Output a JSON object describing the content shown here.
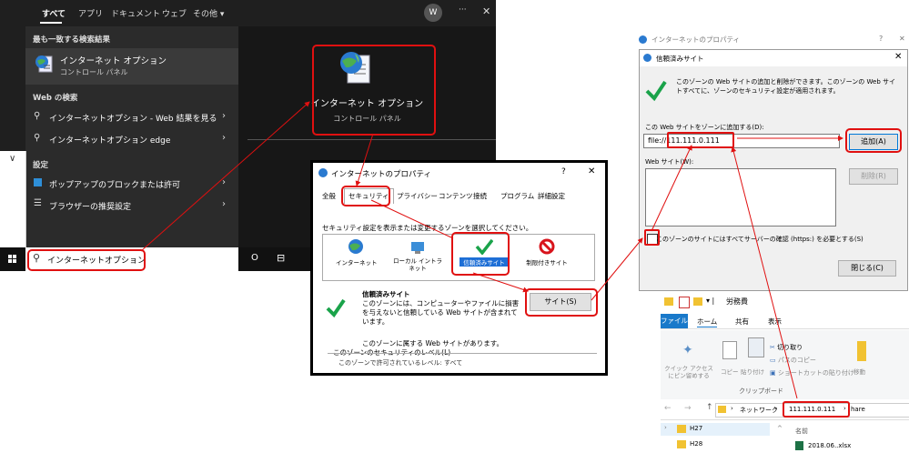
{
  "search": {
    "tabs": [
      "すべて",
      "アプリ",
      "ドキュメント",
      "ウェブ",
      "その他 ▾"
    ],
    "avatar": "W",
    "more": "···",
    "close": "✕",
    "best_match_header": "最も一致する検索結果",
    "best_match_title": "インターネット オプション",
    "best_match_sub": "コントロール パネル",
    "web_header": "Web の検索",
    "web_items": [
      "インターネットオプション - Web 結果を見る",
      "インターネットオプション edge"
    ],
    "settings_header": "設定",
    "settings_items": [
      "ポップアップのブロックまたは許可",
      "ブラウザーの推奨設定"
    ],
    "detail_title": "インターネット オプション",
    "detail_sub": "コントロール パネル",
    "query": "インターネットオプション",
    "chevron": "∨"
  },
  "props1": {
    "title": "インターネットのプロパティ",
    "help": "?",
    "close": "✕",
    "tabs": [
      "全般",
      "セキュリティ",
      "プライバシー",
      "コンテンツ",
      "接続",
      "プログラム",
      "詳細設定"
    ],
    "instruction": "セキュリティ設定を表示または変更するゾーンを選択してください。",
    "zones": [
      "インターネット",
      "ローカル イントラネット",
      "信頼済みサイト",
      "制限付きサイト"
    ],
    "zone_title": "信頼済みサイト",
    "zone_desc": "このゾーンには、コンピューターやファイルに損害を与えないと信頼している Web サイトが含まれています。",
    "sites_button": "サイト(S)",
    "zone_note": "このゾーンに属する Web サイトがあります。",
    "level_label": "このゾーンのセキュリティのレベル(L)",
    "cut_text": "このゾーンで許可されているレベル: すべて"
  },
  "props2": {
    "title": "インターネットのプロパティ",
    "help": "?",
    "close": "✕"
  },
  "trusted": {
    "title": "信頼済みサイト",
    "close": "✕",
    "info": "このゾーンの Web サイトの追加と削除ができます。このゾーンの Web サイトすべてに、ゾーンのセキュリティ設定が適用されます。",
    "add_label": "この Web サイトをゾーンに追加する(D):",
    "url_value": "file://111.111.0.111",
    "add_button": "追加(A)",
    "list_label": "Web サイト(W):",
    "remove_button": "削除(R)",
    "https_label": "このゾーンのサイトにはすべてサーバーの確認 (https:) を必要とする(S)",
    "close_button": "閉じる(C)"
  },
  "explorer": {
    "title": "労務費",
    "ribbon_tabs": [
      "ファイル",
      "ホーム",
      "共有",
      "表示"
    ],
    "pin_label": "クイック アクセス にピン留めする",
    "copy_label": "コピー",
    "paste_label": "貼り付け",
    "cut_label": "切り取り",
    "copy_path_label": "パスのコピー",
    "shortcut_label": "ショートカットの貼り付け",
    "move_label": "移動",
    "clipboard_group": "クリップボード",
    "breadcrumb_network": "ネットワーク",
    "breadcrumb_ip": "111.111.0.111",
    "breadcrumb_next": "hare",
    "tree_items": [
      "H27",
      "H28"
    ],
    "col_name": "名前",
    "file_name": "2018.06..xlsx"
  },
  "taskbar": {
    "cortana": "O",
    "taskview": "⊟"
  }
}
